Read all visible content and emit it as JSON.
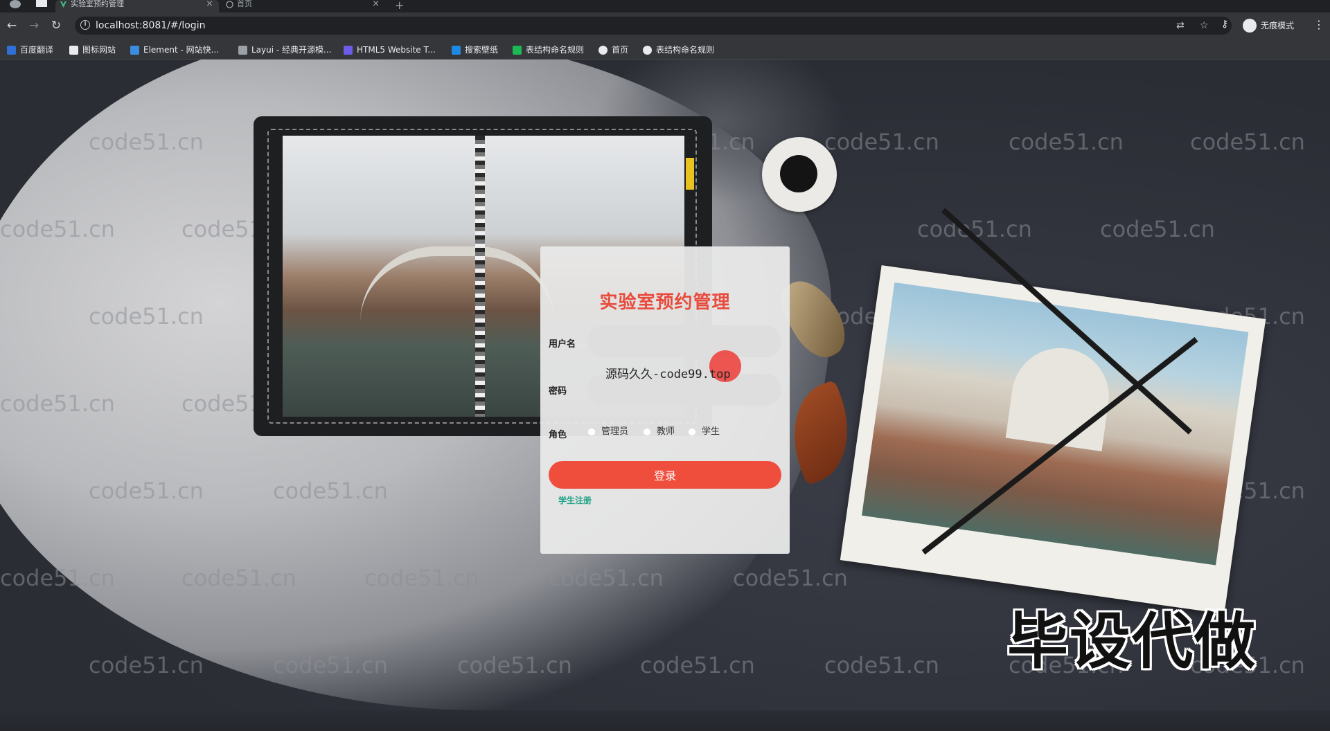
{
  "browser": {
    "tabs": [
      {
        "label": "实验室预约管理",
        "active": true
      },
      {
        "label": "首页",
        "active": false
      }
    ],
    "new_tab": "+",
    "tab_close": "×",
    "url": "localhost:8081/#/login",
    "incognito_label": "无痕模式",
    "bookmarks": [
      {
        "label": "百度翻译",
        "icon_color": "#2f6fd6"
      },
      {
        "label": "图标网站",
        "icon_color": "#e8eaed"
      },
      {
        "label": "Element - 网站快...",
        "icon_color": "#3b8de0"
      },
      {
        "label": "Layui - 经典开源模...",
        "icon_color": "#9aa0a6"
      },
      {
        "label": "HTML5 Website T...",
        "icon_color": "#6c5ce7"
      },
      {
        "label": "搜索壁纸",
        "icon_color": "#1e88e5"
      },
      {
        "label": "表结构命名规则",
        "icon_color": "#1db954"
      },
      {
        "label": "首页",
        "icon_color": "#e8eaed"
      },
      {
        "label": "表结构命名规则",
        "icon_color": "#e8eaed"
      }
    ]
  },
  "login": {
    "title": "实验室预约管理",
    "username_label": "用户名",
    "username_value": "",
    "password_label": "密码",
    "password_value": "",
    "role_label": "角色",
    "roles": [
      "管理员",
      "教师",
      "学生"
    ],
    "submit_label": "登录",
    "register_link": "学生注册"
  },
  "overlay": {
    "watermark_site": "code51.cn",
    "source_watermark": "源码久久-code99.top",
    "promo_text": "毕设代做"
  },
  "colors": {
    "title_red": "#e84b3c",
    "button_red": "#f04e3d",
    "link_teal": "#1fa188"
  }
}
